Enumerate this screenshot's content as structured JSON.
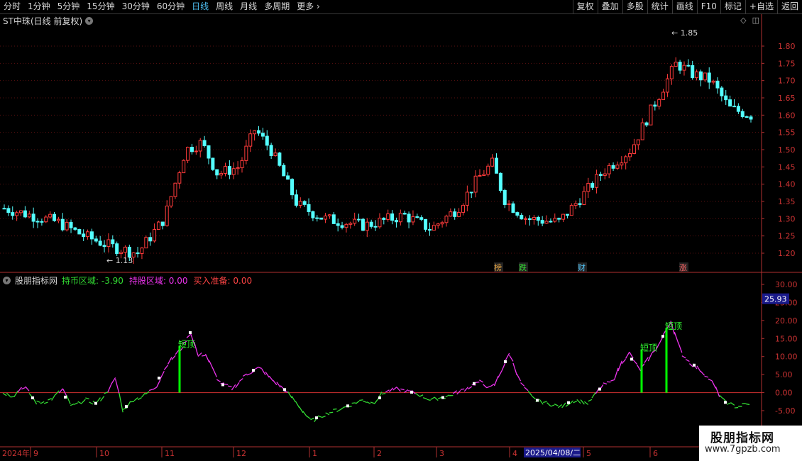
{
  "toolbar": {
    "periods": [
      {
        "label": "分时",
        "active": false
      },
      {
        "label": "1分钟",
        "active": false
      },
      {
        "label": "5分钟",
        "active": false
      },
      {
        "label": "15分钟",
        "active": false
      },
      {
        "label": "30分钟",
        "active": false
      },
      {
        "label": "60分钟",
        "active": false
      },
      {
        "label": "日线",
        "active": true
      },
      {
        "label": "周线",
        "active": false
      },
      {
        "label": "月线",
        "active": false
      },
      {
        "label": "多周期",
        "active": false
      },
      {
        "label": "更多",
        "active": false
      }
    ],
    "actions": [
      "复权",
      "叠加",
      "多股",
      "统计",
      "画线",
      "F10",
      "标记",
      "+自选",
      "返回"
    ]
  },
  "main_chart": {
    "title": "ST中珠(日线 前复权)",
    "price_axis": [
      "1.80",
      "1.75",
      "1.70",
      "1.65",
      "1.60",
      "1.55",
      "1.50",
      "1.45",
      "1.40",
      "1.35",
      "1.30",
      "1.25",
      "1.20"
    ],
    "high_label": "1.85",
    "low_label": "1.13",
    "event_tags": [
      "榜",
      "跌",
      "财",
      "涨"
    ]
  },
  "indicator": {
    "name": "股朋指标网",
    "fields": [
      {
        "label": "持币区域:",
        "value": "-3.90",
        "color": "#33dd33"
      },
      {
        "label": "持股区域:",
        "value": "0.00",
        "color": "#ee33ee"
      },
      {
        "label": "买入准备:",
        "value": "0.00",
        "color": "#ff4444"
      }
    ],
    "axis": [
      "30.00",
      "25.00",
      "20.00",
      "15.00",
      "10.00",
      "5.00",
      "0.00",
      "-5.00"
    ],
    "current_value": "25.93",
    "signal_label": "短顶"
  },
  "date_axis": {
    "year_label": "2024年",
    "months": [
      "9",
      "10",
      "11",
      "12",
      "1",
      "2",
      "3",
      "4",
      "5",
      "6"
    ],
    "cursor_date": "2025/04/08/二"
  },
  "watermark": {
    "title": "股朋指标网",
    "url": "www.7gpzb.com"
  },
  "colors": {
    "up": "#ff3b3b",
    "down": "#54ffff",
    "hold_stock": "#ee33ee",
    "hold_cash": "#33dd33",
    "signal": "#00ff00"
  }
}
